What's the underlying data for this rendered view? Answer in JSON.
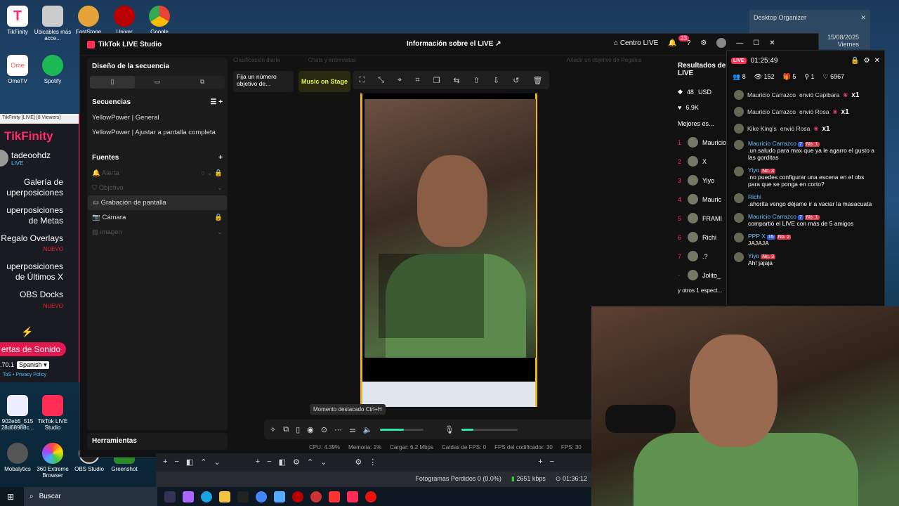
{
  "desktop": {
    "icons": [
      {
        "label": "TikFinity",
        "color": "#ff2d6a",
        "x": "a"
      },
      {
        "label": "Ubicables más acce...",
        "color": "#333"
      },
      {
        "label": "FastStone",
        "color": "#c33"
      },
      {
        "label": "Univer",
        "color": "#c00"
      },
      {
        "label": "Google",
        "color": "#4285f4"
      },
      {
        "label": "OmeTV",
        "color": "#e55"
      },
      {
        "label": "Spotify",
        "color": "#1db954"
      },
      {
        "label": "902eb5_515 28d68988c...",
        "color": "#4aa0e0"
      },
      {
        "label": "TikTok LIVE Studio",
        "color": "#ff2d55"
      },
      {
        "label": "Mobalytics",
        "color": "#555"
      },
      {
        "label": "360 Extreme Browser",
        "color": "#f80"
      },
      {
        "label": "OBS Studio",
        "color": "#222"
      },
      {
        "label": "Greenshot",
        "color": "#2a2"
      }
    ]
  },
  "organizer": {
    "title": "Desktop Organizer",
    "date": "15/08/2025",
    "day": "Viernes"
  },
  "tikfinity": {
    "window_title": "TikFinity [LIVE] [8 Viewers]",
    "logo": "TikFinity",
    "user": "tadeoohdz",
    "status": "LIVE",
    "menu": [
      {
        "label": "Galería de uperposiciones",
        "badge": ""
      },
      {
        "label": "uperposiciones de Metas",
        "badge": ""
      },
      {
        "label": "Regalo Overlays",
        "badge": "NUEVO"
      },
      {
        "label": "uperposiciones de Últimos X",
        "badge": ""
      },
      {
        "label": "OBS Docks",
        "badge": "NUEVO"
      }
    ],
    "alert_button": "ertas de Sonido",
    "version": ".70.1",
    "language": "Spanish",
    "footer": "ToS • Privacy Policy"
  },
  "studio": {
    "app_name": "TikTok LIVE Studio",
    "title": "Información sobre el LIVE",
    "centro": "Centro LIVE",
    "notif_count": "23",
    "left": {
      "design_title": "Diseño de la secuencia",
      "sequences_title": "Secuencias",
      "sequences": [
        "YellowPower | General",
        "YellowPower | Ajustar a pantalla completa"
      ],
      "sources_title": "Fuentes",
      "sources": [
        {
          "label": "Alerta",
          "state": "dim"
        },
        {
          "label": "Objetivo",
          "state": "dim"
        },
        {
          "label": "Grabación de pantalla",
          "state": "sel"
        },
        {
          "label": "Cámara",
          "state": "normal"
        },
        {
          "label": "imagen",
          "state": "dim"
        }
      ],
      "tools": "Herramientas"
    },
    "top_strip": [
      "Clasificación diaria",
      "Chats y entrevistas",
      "Añadir un objetivo de Regalos"
    ],
    "pin_goal": "Fija un número objetivo de...",
    "music": "Music on Stage",
    "tooltip": "Momento destacado Ctrl+H",
    "volume_level": 0.55,
    "mic_level": 0.22,
    "stats": [
      "CPU:  4.39%",
      "Memoria:  1%",
      "Cargar:  6.2 Mbps",
      "Caídas de FPS:  0",
      "FPS del codificador:  30",
      "FPS:  30"
    ],
    "results": {
      "title": "Resultados del LIVE",
      "coins": "48",
      "usd": "USD",
      "likes": "6.9K",
      "best": "Mejores es...",
      "ranking": [
        {
          "n": "1",
          "name": "Mauricio"
        },
        {
          "n": "2",
          "name": "X"
        },
        {
          "n": "3",
          "name": "Yiyo"
        },
        {
          "n": "4",
          "name": "Mauric"
        },
        {
          "n": "5",
          "name": "FRAMI"
        },
        {
          "n": "6",
          "name": "Richi"
        },
        {
          "n": "7",
          "name": ".?"
        },
        {
          "n": "-",
          "name": "Jolito_"
        }
      ],
      "others": "y otros 1 espect..."
    }
  },
  "chat": {
    "live": "LIVE",
    "time": "01:25:49",
    "stats": [
      "8",
      "152",
      "5",
      "1",
      "6967"
    ],
    "gifts": [
      {
        "user": "Mauricio Carrazco",
        "text": "envió Capibara",
        "count": "x1"
      },
      {
        "user": "Mauricio Carrazco",
        "text": "envió Rosa",
        "count": "x1"
      },
      {
        "user": "Kike King's",
        "text": "envió Rosa",
        "count": "x1"
      }
    ],
    "messages": [
      {
        "user": "Mauricio Carrazco",
        "level": "7",
        "rank": "No. 1",
        "text": ".un saludo para max que ya le agarro el gusto a las gorditas"
      },
      {
        "user": "Yiyo",
        "level": "",
        "rank": "No. 3",
        "text": ".no puedes configurar una escena en el obs para que se ponga en corto?"
      },
      {
        "user": "Richi",
        "level": "",
        "rank": "",
        "text": ".ahorita vengo déjame ir a vaciar la masacuata"
      },
      {
        "user": "Mauricio Carrazco",
        "level": "7",
        "rank": "No. 1",
        "text": "compartió el LIVE con más de 5 amigos"
      },
      {
        "user": "PPP X",
        "level": "15",
        "rank": "No. 2",
        "text": "JAJAJA"
      },
      {
        "user": "Yiyo",
        "level": "",
        "rank": "No. 3",
        "text": "Ah! jajaja"
      }
    ]
  },
  "obs": {
    "frames": "Fotogramas Perdidos 0 (0.0%)",
    "kbps": "2651 kbps",
    "time": "01:36:12"
  },
  "taskbar": {
    "search": "Buscar"
  }
}
